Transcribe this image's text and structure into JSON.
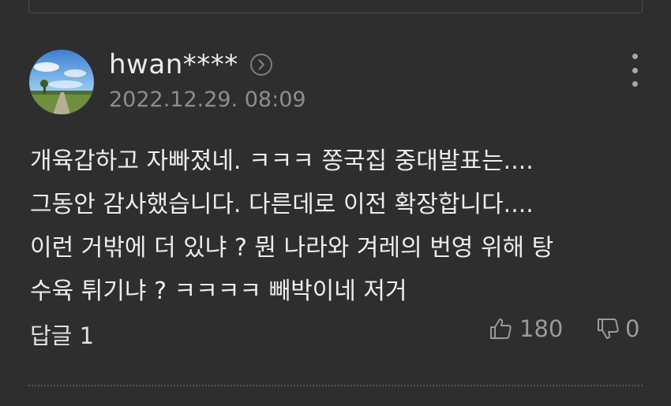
{
  "comment": {
    "author": "hwan****",
    "date": "2022.12.29. 08:09",
    "lines": [
      "개육갑하고 자빠졌네. ㅋㅋㅋ 쫑국집 중대발표는....",
      "그동안 감사했습니다. 다른데로 이전 확장합니다....",
      "이런 거밖에 더 있냐 ? 뭔 나라와 겨레의 번영 위해 탕",
      "수육 튀기냐 ? ㅋㅋㅋㅋ 빼박이네 저거"
    ],
    "reply_label": "답글 1",
    "likes": "180",
    "dislikes": "0"
  },
  "icons": {
    "profile_more": "chevron-right-circle-icon",
    "menu": "more-vertical-icon",
    "like": "thumbs-up-icon",
    "dislike": "thumbs-down-icon"
  },
  "colors": {
    "background": "#2e2e2f",
    "text": "#ededed",
    "muted": "#8d8d8f"
  }
}
